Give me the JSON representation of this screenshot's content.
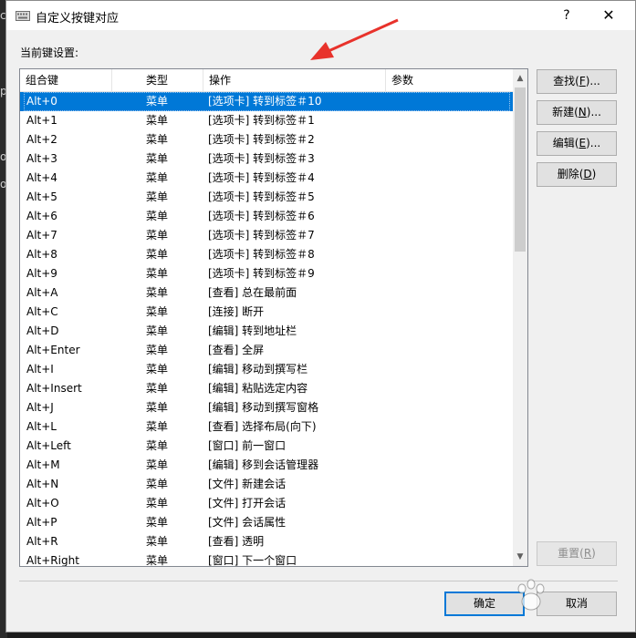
{
  "window": {
    "title": "自定义按键对应",
    "help_label": "?",
    "close_label": "✕"
  },
  "background": {
    "glyphs": [
      "c",
      "o",
      "o",
      "p"
    ]
  },
  "section_label": "当前键设置:",
  "columns": [
    "组合键",
    "类型",
    "操作",
    "参数"
  ],
  "rows": [
    {
      "key": "Alt+0",
      "type": "菜单",
      "action": "[选项卡] 转到标签＃10",
      "param": "",
      "selected": true
    },
    {
      "key": "Alt+1",
      "type": "菜单",
      "action": "[选项卡] 转到标签＃1",
      "param": ""
    },
    {
      "key": "Alt+2",
      "type": "菜单",
      "action": "[选项卡] 转到标签＃2",
      "param": ""
    },
    {
      "key": "Alt+3",
      "type": "菜单",
      "action": "[选项卡] 转到标签＃3",
      "param": ""
    },
    {
      "key": "Alt+4",
      "type": "菜单",
      "action": "[选项卡] 转到标签＃4",
      "param": ""
    },
    {
      "key": "Alt+5",
      "type": "菜单",
      "action": "[选项卡] 转到标签＃5",
      "param": ""
    },
    {
      "key": "Alt+6",
      "type": "菜单",
      "action": "[选项卡] 转到标签＃6",
      "param": ""
    },
    {
      "key": "Alt+7",
      "type": "菜单",
      "action": "[选项卡] 转到标签＃7",
      "param": ""
    },
    {
      "key": "Alt+8",
      "type": "菜单",
      "action": "[选项卡] 转到标签＃8",
      "param": ""
    },
    {
      "key": "Alt+9",
      "type": "菜单",
      "action": "[选项卡] 转到标签＃9",
      "param": ""
    },
    {
      "key": "Alt+A",
      "type": "菜单",
      "action": "[查看] 总在最前面",
      "param": ""
    },
    {
      "key": "Alt+C",
      "type": "菜单",
      "action": "[连接] 断开",
      "param": ""
    },
    {
      "key": "Alt+D",
      "type": "菜单",
      "action": "[编辑] 转到地址栏",
      "param": ""
    },
    {
      "key": "Alt+Enter",
      "type": "菜单",
      "action": "[查看] 全屏",
      "param": ""
    },
    {
      "key": "Alt+I",
      "type": "菜单",
      "action": "[编辑] 移动到撰写栏",
      "param": ""
    },
    {
      "key": "Alt+Insert",
      "type": "菜单",
      "action": "[编辑] 粘贴选定内容",
      "param": ""
    },
    {
      "key": "Alt+J",
      "type": "菜单",
      "action": "[编辑] 移动到撰写窗格",
      "param": ""
    },
    {
      "key": "Alt+L",
      "type": "菜单",
      "action": "[查看] 选择布局(向下)",
      "param": ""
    },
    {
      "key": "Alt+Left",
      "type": "菜单",
      "action": "[窗口] 前一窗口",
      "param": ""
    },
    {
      "key": "Alt+M",
      "type": "菜单",
      "action": "[编辑] 移到会话管理器",
      "param": ""
    },
    {
      "key": "Alt+N",
      "type": "菜单",
      "action": "[文件] 新建会话",
      "param": ""
    },
    {
      "key": "Alt+O",
      "type": "菜单",
      "action": "[文件] 打开会话",
      "param": ""
    },
    {
      "key": "Alt+P",
      "type": "菜单",
      "action": "[文件] 会话属性",
      "param": ""
    },
    {
      "key": "Alt+R",
      "type": "菜单",
      "action": "[查看] 透明",
      "param": ""
    },
    {
      "key": "Alt+Right",
      "type": "菜单",
      "action": "[窗口] 下一个窗口",
      "param": ""
    }
  ],
  "buttons": {
    "find": {
      "label": "查找(",
      "mnemonic": "F",
      "suffix": ")..."
    },
    "new": {
      "label": "新建(",
      "mnemonic": "N",
      "suffix": ")..."
    },
    "edit": {
      "label": "编辑(",
      "mnemonic": "E",
      "suffix": ")..."
    },
    "delete": {
      "label": "删除(",
      "mnemonic": "D",
      "suffix": ")"
    },
    "reset": {
      "label": "重置(",
      "mnemonic": "R",
      "suffix": ")"
    },
    "ok": {
      "label": "确定"
    },
    "cancel": {
      "label": "取消"
    }
  },
  "watermark": {
    "text": "Bai 百"
  },
  "colors": {
    "selection": "#0078d7",
    "annotation_arrow": "#e8322b"
  }
}
